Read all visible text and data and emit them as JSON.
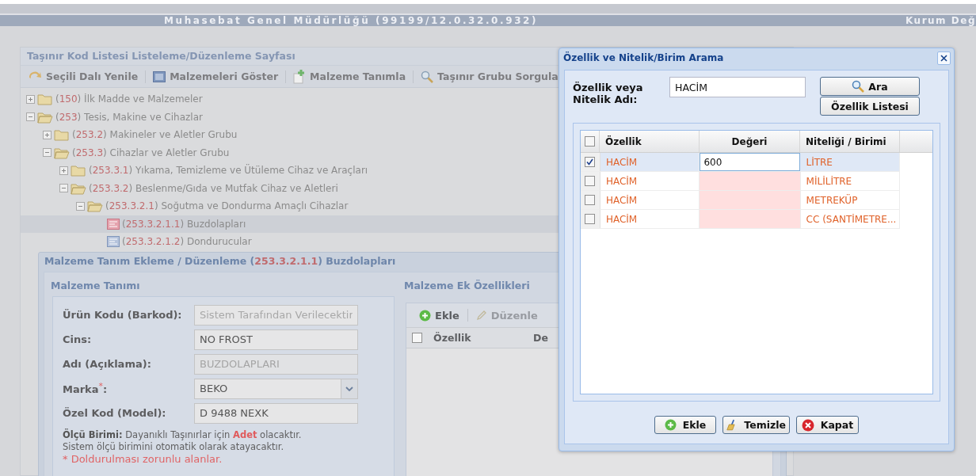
{
  "header": {
    "title": "Muhasebat Genel Müdürlüğü (99199/12.0.32.0.932)",
    "right_text": "Kurum Değ"
  },
  "main_panel": {
    "title": "Taşınır Kod Listesi Listeleme/Düzenleme Sayfası",
    "toolbar": [
      {
        "label": "Seçili Dalı Yenile"
      },
      {
        "label": "Malzemeleri Göster"
      },
      {
        "label": "Malzeme Tanımla"
      },
      {
        "label": "Taşınır Grubu Sorgula"
      }
    ],
    "tree": [
      {
        "kind": "folder",
        "text": "(**150**) İlk Madde ve Malzemeler",
        "expanded": false
      },
      {
        "kind": "folder",
        "text": "(**253**) Tesis, Makine ve Cihazlar",
        "expanded": true,
        "children": [
          {
            "kind": "folder",
            "text": "(**253.2**) Makineler ve Aletler Grubu",
            "expanded": false
          },
          {
            "kind": "folder",
            "text": "(**253.3**) Cihazlar ve Aletler Grubu",
            "expanded": true,
            "children": [
              {
                "kind": "folder",
                "text": "(**253.3.1**) Yıkama, Temizleme ve Ütüleme Cihaz ve Araçları",
                "expanded": false
              },
              {
                "kind": "folder",
                "text": "(**253.3.2**) Beslenme/Gıda ve Mutfak Cihaz ve Aletleri",
                "expanded": true,
                "children": [
                  {
                    "kind": "folder",
                    "text": "(**253.3.2.1**) Soğutma ve Dondurma Amaçlı Cihazlar",
                    "expanded": true,
                    "children": [
                      {
                        "kind": "leaf",
                        "text": "(**253.3.2.1.1**) Buzdolapları",
                        "selected": true
                      },
                      {
                        "kind": "leaf",
                        "text": "(**253.3.2.1.2**) Dondurucular",
                        "selected": false
                      }
                    ]
                  }
                ]
              }
            ]
          }
        ]
      }
    ]
  },
  "material_dialog": {
    "title": "Malzeme Tanım Ekleme / Düzenleme (**253.3.2.1.1**) Buzdolapları",
    "definition": {
      "legend": "Malzeme Tanımı",
      "fields": [
        {
          "label": "Ürün Kodu (Barkod):",
          "kind": "text",
          "placeholder": "Sistem Tarafından Verilecektir"
        },
        {
          "label": "Cins:",
          "kind": "text",
          "value": "NO FROST"
        },
        {
          "label": "Adı (Açıklama):",
          "kind": "text",
          "value": "BUZDOLAPLARI",
          "disabled": true
        },
        {
          "label": "Marka$^{*}$:",
          "kind": "select",
          "value": "BEKO"
        },
        {
          "label": "Özel Kod (Model):",
          "kind": "text",
          "value": "D 9488 NEXK"
        }
      ],
      "notes": [
        {
          "kind": "info",
          "text": "**Ölçü Birimi:** Dayanıklı Taşınırlar için *Adet* olacaktır."
        },
        {
          "kind": "info",
          "text": "Sistem ölçü birimini otomatik olarak atayacaktır."
        },
        {
          "kind": "required",
          "text": "* Doldurulması zorunlu alanlar."
        }
      ]
    },
    "extras": {
      "legend": "Malzeme Ek Özellikleri",
      "toolbar": [
        {
          "label": "Ekle",
          "disabled": false
        },
        {
          "label": "Düzenle",
          "disabled": true
        }
      ],
      "all_checked": false,
      "columns": [
        "Özellik",
        "De"
      ]
    }
  },
  "search_dialog": {
    "title": "Özellik ve Nitelik/Birim Arama",
    "search_label": "Özellik veya Nitelik Adı:",
    "search_value": "HACİM",
    "side_buttons": [
      "Ara",
      "Özellik Listesi"
    ],
    "all_checked": false,
    "columns": [
      "Özellik",
      "Değeri",
      "Niteliği / Birimi"
    ],
    "rows": [
      {
        "property": "HACİM",
        "value": "600",
        "unit": "LİTRE",
        "checked": true,
        "selected": true
      },
      {
        "property": "HACİM",
        "unit": "MİLİLİTRE",
        "checked": false,
        "selected": false
      },
      {
        "property": "HACİM",
        "unit": "METREKÜP",
        "checked": false,
        "selected": false
      },
      {
        "property": "HACİM",
        "unit": "CC (SANTİMETRE...",
        "checked": false,
        "selected": false
      }
    ],
    "buttons": [
      "Ekle",
      "Temizle",
      "Kapat"
    ]
  }
}
